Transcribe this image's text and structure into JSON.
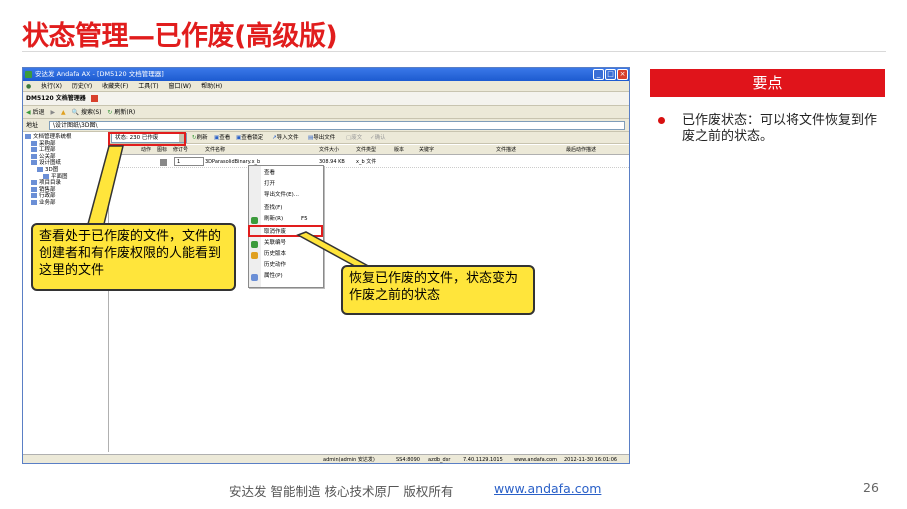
{
  "slide": {
    "title": "状态管理—已作废(高级版)",
    "page_number": "26",
    "footer_text": "安达发   智能制造 核心技术原厂    版权所有",
    "footer_link": "www.andafa.com"
  },
  "window": {
    "title": "安达发 Andafa AX - [DM5120 文档管理器]",
    "menu": [
      "执行(X)",
      "历史(Y)",
      "收藏夹(F)",
      "工具(T)",
      "窗口(W)",
      "帮助(H)"
    ],
    "doc_tab": "DM5120 文档管理器",
    "nav": [
      "后退",
      "搜索(S)",
      "刷新(R)"
    ],
    "address_label": "地址",
    "address_value": "\\设计图纸\\3D图\\",
    "tree": [
      "文档管理系统根",
      "采购部",
      "工程部",
      "公关部",
      "设计图纸",
      "3D图",
      "平面图",
      "项目目录",
      "销售部",
      "行政部",
      "业务部"
    ],
    "status_label": "状态:",
    "status_value": "230 已作废",
    "toolbar": [
      "刷新",
      "查看",
      "查看锁定",
      "导入文件",
      "导出文件",
      "废文",
      "确认"
    ],
    "grid_headers": [
      "类型",
      "动作",
      "图标",
      "修订号",
      "文件名称",
      "文件大小",
      "文件类型",
      "版本",
      "关键字",
      "文件描述",
      "最后动作描述"
    ],
    "grid_row": {
      "revision": "1",
      "filename": "3DParasolidBinary.x_b",
      "size": "308.94 KB",
      "type": "x_b 文件"
    },
    "context_menu": [
      "查看",
      "打开",
      "导出文件(E)...",
      "查找(F)",
      "刷新(R)",
      "取消作废",
      "关联编号",
      "历史版本",
      "历史动作",
      "属性(P)"
    ],
    "refresh_shortcut": "F5",
    "statusbar": [
      "admin(admin 安达发)",
      "SS4:8090",
      "azdb_dsr",
      "7.40.1129.1015",
      "www.andafa.com",
      "2012-11-30 16:01:06"
    ]
  },
  "callouts": {
    "left": "查看处于已作废的文件，文件的创建者和有作废权限的人能看到这里的文件",
    "right": "恢复已作废的文件，状态变为作废之前的状态"
  },
  "panel": {
    "heading": "要点",
    "bullet": "已作废状态：可以将文件恢复到作废之前的状态。"
  },
  "colors": {
    "accent": "#e11d1d",
    "callout": "#ffe53b",
    "panel_head": "#e0141b",
    "link": "#2a60c8"
  }
}
